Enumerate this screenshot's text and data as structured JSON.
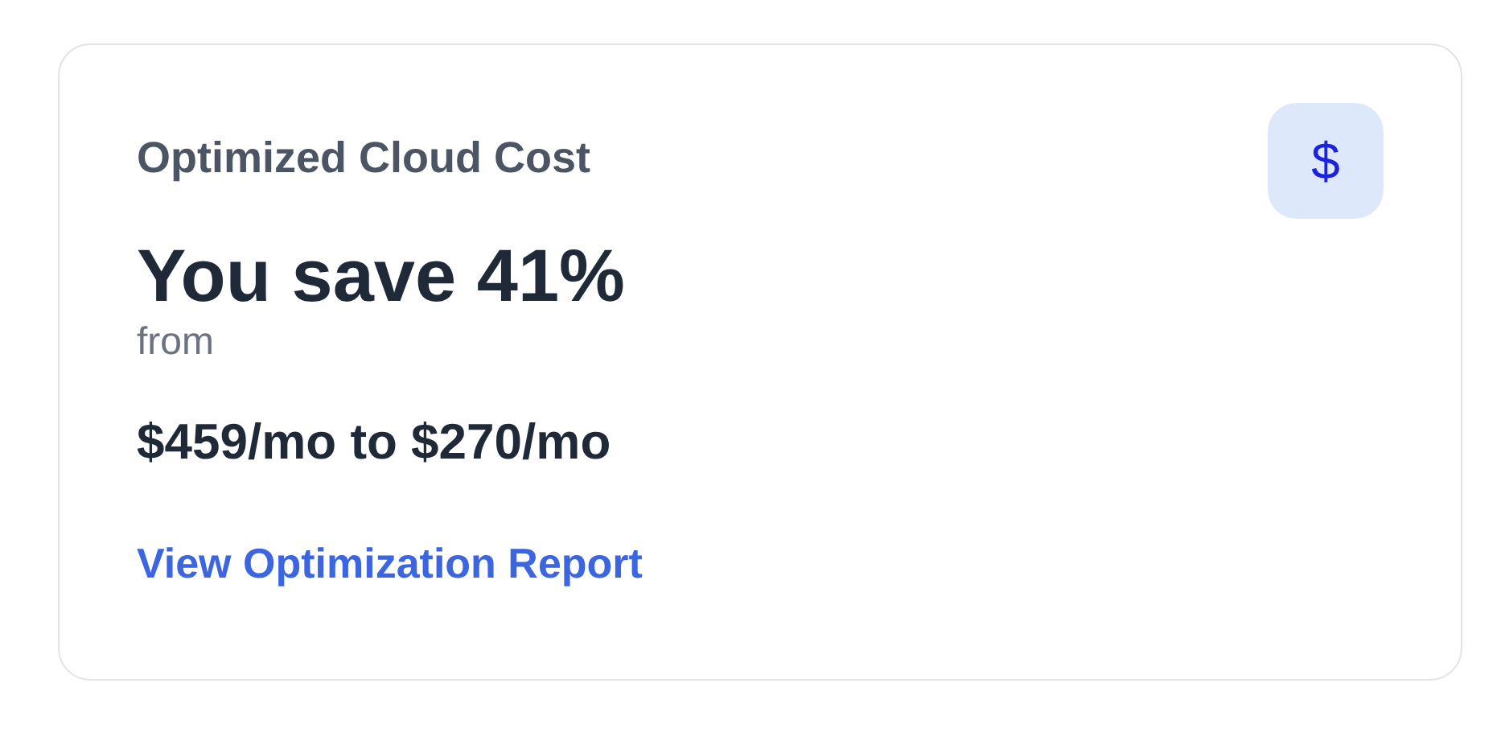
{
  "card": {
    "title": "Optimized Cloud Cost",
    "badge": "$",
    "headline": "You save 41%",
    "from_label": "from",
    "range": "$459/mo to $270/mo",
    "link": "View Optimization Report"
  }
}
